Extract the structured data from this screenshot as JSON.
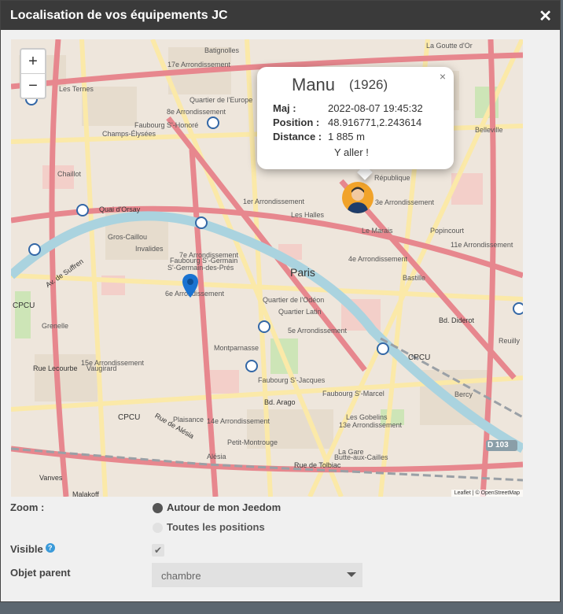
{
  "dialog": {
    "title": "Localisation de vos équipements JC",
    "close_glyph": "✕"
  },
  "map": {
    "zoom_in": "+",
    "zoom_out": "−",
    "attribution": "Leaflet | © OpenStreetMap",
    "labels": {
      "batignolles": "Batignolles",
      "goutte_dor": "La Goutte d'Or",
      "arr17": "17e Arrondissement",
      "ternes": "Les Ternes",
      "quartier_europe": "Quartier de l'Europe",
      "arr8": "8e Arrondissement",
      "faubourg_st_honore": "Faubourg S'-Honoré",
      "champs_elysees": "Champs-Élysées",
      "chaillot": "Chaillot",
      "arr1": "1er Arrondissement",
      "halles": "Les Halles",
      "arr3": "3e Arrondissement",
      "marais": "Le Marais",
      "republique": "République",
      "belleville": "Belleville",
      "arr11": "11e Arrondissement",
      "popincourt": "Popincourt",
      "bastille": "Bastille",
      "paris": "Paris",
      "arr4": "4e Arrondissement",
      "arr7": "7e Arrondissement",
      "faubourg_st_germain": "Faubourg S'-Germain",
      "st_germain_pres": "S'-Germain-des-Prés",
      "arr6": "6e Arrondissement",
      "odeon": "Quartier de l'Odéon",
      "quartier_latin": "Quartier Latin",
      "arr5": "5e Arrondissement",
      "grenelle": "Grenelle",
      "montparnasse": "Montparnasse",
      "arr15": "15e Arrondissement",
      "vaugirard": "Vaugirard",
      "st_jacques": "Faubourg S'-Jacques",
      "st_marcel": "Faubourg S'-Marcel",
      "gobelins": "Les Gobelins",
      "arr13": "13e Arrondissement",
      "arr14": "14e Arrondissement",
      "plaisance": "Plaisance",
      "petit_montrouge": "Petit-Montrouge",
      "alesia": "Alésia",
      "gare": "La Gare",
      "butte_cailles": "Butte-aux-Cailles",
      "bercy": "Bercy",
      "reuilly": "Reuilly",
      "invalides": "Invalides",
      "gros_caillou": "Gros-Caillou",
      "cpcu1": "CPCU",
      "cpcu2": "CPCU",
      "cpcu3": "CPCU",
      "d103": "D 103",
      "quai_orsay": "Quai d'Orsay",
      "bd_arago": "Bd. Arago",
      "rue_alesia": "Rue de Alésia",
      "rue_tolbiac": "Rue de Tolbiac",
      "bd_diderot": "Bd. Diderot",
      "malakoff": "Malakoff",
      "vanves": "Vanves",
      "av_suffren": "Av. de Suffren",
      "rue_lecourbe": "Rue Lecourbe"
    }
  },
  "popup": {
    "close": "×",
    "name": "Manu",
    "id": "(1926)",
    "maj_label": "Maj :",
    "maj_value": "2022-08-07 19:45:32",
    "position_label": "Position :",
    "position_value": "48.916771,2.243614",
    "distance_label": "Distance :",
    "distance_value": "1 885 m",
    "link": "Y aller !"
  },
  "form": {
    "zoom_label": "Zoom :",
    "zoom_options": [
      "Autour de mon Jeedom",
      "Toutes les positions"
    ],
    "zoom_selected": "Autour de mon Jeedom",
    "visible_label": "Visible",
    "help_glyph": "?",
    "visible_checked": true,
    "check_glyph": "✔",
    "parent_label": "Objet parent",
    "parent_value": "chambre"
  }
}
